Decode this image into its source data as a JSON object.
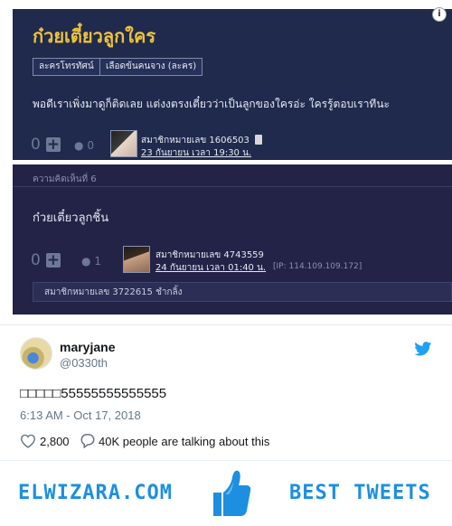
{
  "forum_post": {
    "title": "ก๋วยเตี๋ยวลูกใคร",
    "tags": [
      "ละครโทรทัศน์",
      "เลือดข้นคนจาง (ละคร)"
    ],
    "body": "พอดีเราเพิ่งมาดูก็ติดเลย แต่งงตรงเตี๋ยวว่าเป็นลูกของใครอ่ะ ใครรู้ตอบเราทีนะ",
    "votes": "0",
    "replies": "0",
    "author": "สมาชิกหมายเลข 1606503",
    "date": "23 กันยายน เวลา 19:30 น."
  },
  "forum_comment": {
    "header": "ความคิดเห็นที่ 6",
    "text": "ก๋วยเตี๋ยวลูกชิ้น",
    "votes": "0",
    "replies": "1",
    "author": "สมาชิกหมายเลข 4743559",
    "date": "24 กันยายน เวลา 01:40 น.",
    "ip": "[IP: 114.109.109.172]",
    "reply_preview": "สมาชิกหมายเลข 3722615 ชำกลิ้ง"
  },
  "tweet": {
    "name": "maryjane",
    "handle": "@0330th",
    "text": "□□□□□55555555555555",
    "time": "6:13 AM - Oct 17, 2018",
    "likes": "2,800",
    "talking": "40K people are talking about this"
  },
  "footer": {
    "brand": "ELWIZARA.COM",
    "tagline": "BEST TWEETS"
  },
  "colors": {
    "forum_bg": "#1f2a4d",
    "forum_title": "#f0c23c",
    "twitter_blue": "#1da1f2",
    "brand_blue": "#1d8fe0"
  },
  "icons": [
    "info-icon",
    "plus-icon",
    "reply-icon",
    "phone-icon",
    "twitter-bird-icon",
    "heart-icon",
    "speech-bubble-icon",
    "thumbs-up-icon"
  ]
}
